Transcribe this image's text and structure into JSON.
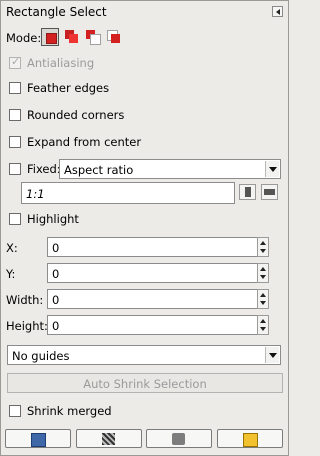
{
  "panel": {
    "title": "Rectangle Select",
    "menu_icon": "tab-menu-icon"
  },
  "mode": {
    "label": "Mode:",
    "buttons": [
      {
        "name": "replace-mode-icon",
        "active": true
      },
      {
        "name": "add-mode-icon",
        "active": false
      },
      {
        "name": "subtract-mode-icon",
        "active": false
      },
      {
        "name": "intersect-mode-icon",
        "active": false
      }
    ]
  },
  "options": {
    "antialiasing": {
      "label": "Antialiasing",
      "checked": true,
      "disabled": true
    },
    "feather_edges": {
      "label": "Feather edges",
      "checked": false
    },
    "rounded_corners": {
      "label": "Rounded corners",
      "checked": false
    },
    "expand_from_center": {
      "label": "Expand from center",
      "checked": false
    },
    "fixed": {
      "label": "Fixed:",
      "checked": false,
      "dropdown_value": "Aspect ratio"
    },
    "ratio_value": "1:1",
    "highlight": {
      "label": "Highlight",
      "checked": false
    },
    "shrink_merged": {
      "label": "Shrink merged",
      "checked": false
    }
  },
  "position_size": {
    "x_label": "X:",
    "x_value": "0",
    "y_label": "Y:",
    "y_value": "0",
    "width_label": "Width:",
    "width_value": "0",
    "height_label": "Height:",
    "height_value": "0"
  },
  "guides": {
    "value": "No guides"
  },
  "auto_shrink": {
    "label": "Auto Shrink Selection"
  },
  "footer": [
    {
      "name": "save-preset-icon"
    },
    {
      "name": "restore-preset-icon"
    },
    {
      "name": "delete-preset-icon"
    },
    {
      "name": "reset-options-icon"
    }
  ],
  "colors": {
    "panel_bg": "#ecebe8",
    "mode_red": "#d32020",
    "mode_gray": "#a8a8a8",
    "disabled_text": "#9b9b9b"
  }
}
